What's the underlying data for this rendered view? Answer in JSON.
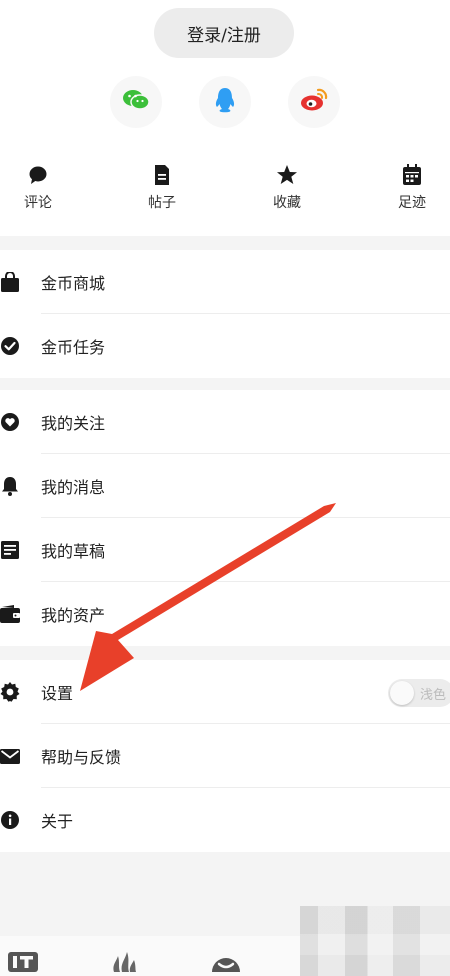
{
  "header": {
    "login_label": "登录/注册"
  },
  "social": [
    {
      "icon": "wechat-icon",
      "color": "#3cbf3a"
    },
    {
      "icon": "qq-icon",
      "color": "#2f9ef3"
    },
    {
      "icon": "weibo-icon",
      "color": "#e6312f"
    }
  ],
  "shortcuts": [
    {
      "icon": "comment-icon",
      "label": "评论"
    },
    {
      "icon": "post-icon",
      "label": "帖子"
    },
    {
      "icon": "star-icon",
      "label": "收藏"
    },
    {
      "icon": "calendar-icon",
      "label": "足迹"
    }
  ],
  "groups": {
    "coins": [
      {
        "icon": "shopping-bag-icon",
        "label": "金币商城"
      },
      {
        "icon": "check-circle-icon",
        "label": "金币任务"
      }
    ],
    "mine": [
      {
        "icon": "heart-circle-icon",
        "label": "我的关注"
      },
      {
        "icon": "bell-icon",
        "label": "我的消息"
      },
      {
        "icon": "draft-icon",
        "label": "我的草稿"
      },
      {
        "icon": "wallet-icon",
        "label": "我的资产"
      }
    ],
    "misc": [
      {
        "icon": "gear-icon",
        "label": "设置"
      },
      {
        "icon": "mail-icon",
        "label": "帮助与反馈"
      },
      {
        "icon": "info-icon",
        "label": "关于"
      }
    ]
  },
  "theme_toggle": {
    "label": "浅色",
    "on": false
  },
  "colors": {
    "arrow": "#e8402a",
    "icon": "#1a1a1a"
  }
}
